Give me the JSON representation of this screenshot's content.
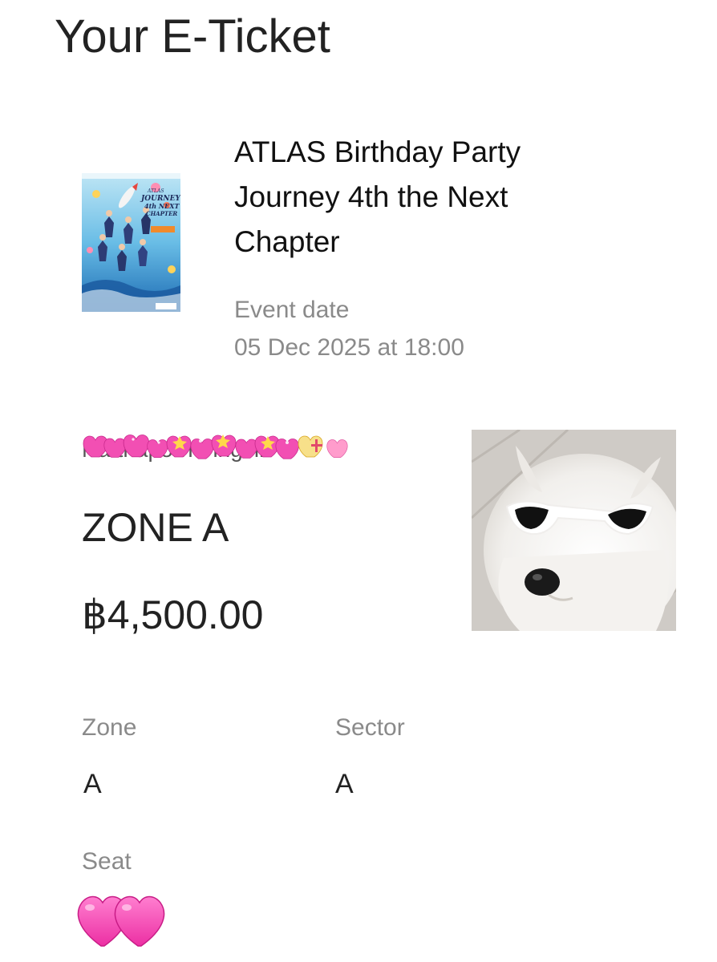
{
  "page": {
    "title": "Your E-Ticket"
  },
  "event": {
    "poster_text": {
      "brand": "ATLAS",
      "line1": "JOURNEY",
      "line2": "4th NEXT",
      "line3": "CHAPTER"
    },
    "title": "ATLAS Birthday Party Journey 4th the Next Chapter",
    "date_label": "Event date",
    "date_value": "05 Dec 2025 at 18:00"
  },
  "ticket": {
    "holder_name": "Natthaporn Yingsiri",
    "zone_heading": "ZONE A",
    "price": "฿4,500.00",
    "fields": {
      "zone_label": "Zone",
      "zone_value": "A",
      "sector_label": "Sector",
      "sector_value": "A",
      "seat_label": "Seat"
    }
  },
  "colors": {
    "heart_pink": "#f24fb3",
    "text_dark": "#222222",
    "text_muted": "#8a8a8a"
  },
  "icons": {
    "name_cover": "pink-hearts-sticker-icon",
    "seat_cover": "two-hearts-icon",
    "photo": "samoyed-sunglasses-photo"
  }
}
